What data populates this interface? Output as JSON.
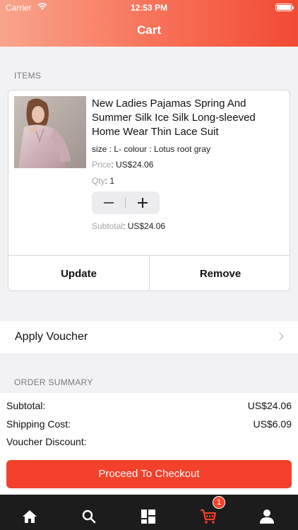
{
  "status_bar": {
    "carrier": "Carrier",
    "time": "12:53 PM"
  },
  "header": {
    "title": "Cart"
  },
  "items_section": {
    "label": "ITEMS"
  },
  "cart_item": {
    "title": "New Ladies Pajamas Spring And Summer Silk Ice Silk Long-sleeved Home Wear Thin Lace Suit",
    "variant": "size :  L- colour :  Lotus root gray",
    "price_label": "Price",
    "price_value": ": US$24.06",
    "qty_label": "Qty",
    "qty_value": ": 1",
    "subtotal_label": "Subtotal",
    "subtotal_value": ": US$24.06",
    "update_label": "Update",
    "remove_label": "Remove"
  },
  "voucher": {
    "label": "Apply Voucher"
  },
  "summary_section": {
    "label": "ORDER SUMMARY"
  },
  "summary": {
    "subtotal_label": "Subtotal:",
    "subtotal_value": "US$24.06",
    "shipping_label": "Shipping Cost:",
    "shipping_value": "US$6.09",
    "voucher_label": "Voucher Discount:",
    "voucher_value": ""
  },
  "checkout": {
    "label": "Proceed To Checkout"
  },
  "tab_bar": {
    "tabs": [
      {
        "icon": "home-icon"
      },
      {
        "icon": "search-icon"
      },
      {
        "icon": "categories-icon"
      },
      {
        "icon": "cart-icon"
      },
      {
        "icon": "profile-icon"
      }
    ],
    "cart_badge": "1",
    "active_color": "#f3412b"
  },
  "colors": {
    "accent": "#f3412b",
    "gradient_start": "#f9a58b",
    "gradient_end": "#f24a33"
  }
}
